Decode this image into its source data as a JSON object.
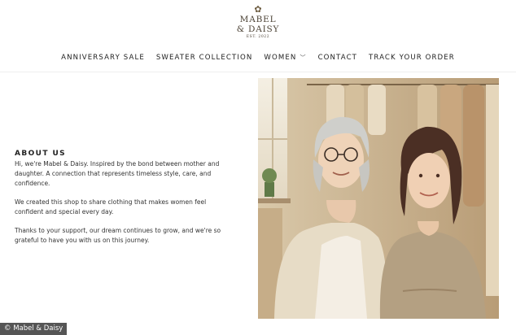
{
  "brand": {
    "mark": "✿",
    "line1": "MABEL",
    "line2": "& DAISY",
    "est": "EST. 2022"
  },
  "nav": {
    "anniversary_sale": "ANNIVERSARY SALE",
    "sweater_collection": "SWEATER COLLECTION",
    "women": "WOMEN",
    "contact": "CONTACT",
    "track_order": "TRACK YOUR ORDER"
  },
  "about": {
    "title": "ABOUT US",
    "p1": "Hi, we're Mabel & Daisy. Inspired by the bond between mother and daughter. A connection that represents timeless style, care, and confidence.",
    "p2": "We created this shop to share clothing that makes women feel confident and special every day.",
    "p3": "Thanks to your support, our dream continues to grow, and we're so grateful to have you with us on this journey."
  },
  "credit": "© Mabel & Daisy",
  "colors": {
    "accent": "#4a4033",
    "photo_background": "#cbb79b"
  },
  "icons": {
    "nav_dropdown": "chevron-down-icon"
  }
}
